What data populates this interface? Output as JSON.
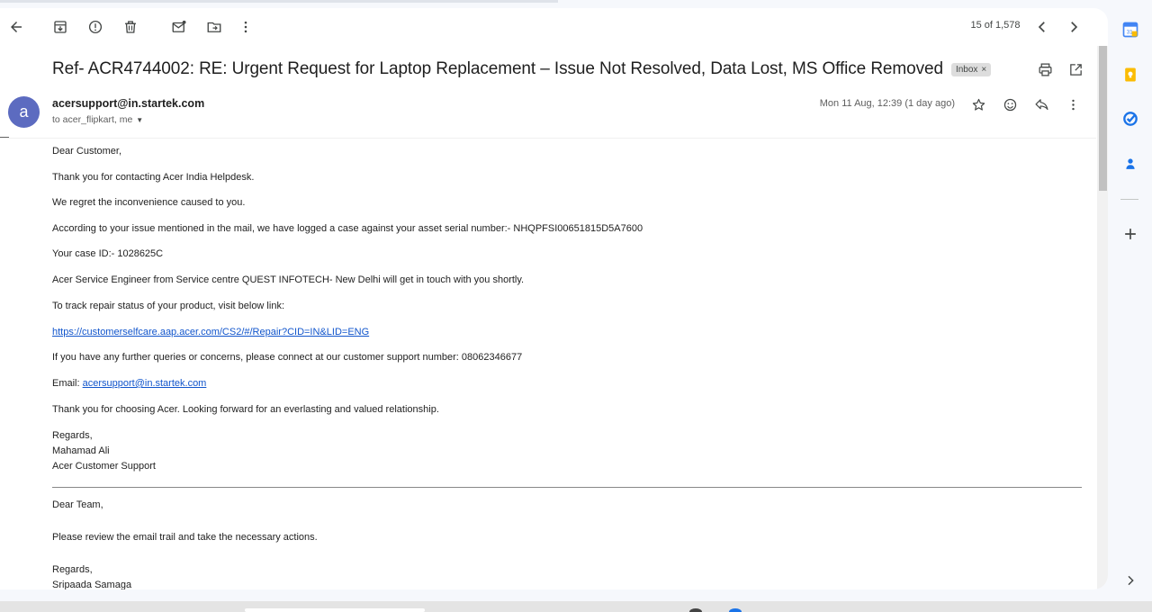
{
  "toolbar": {
    "counter": "15 of 1,578",
    "icons": [
      "back-arrow-icon",
      "archive-icon",
      "report-spam-icon",
      "delete-icon",
      "mark-unread-icon",
      "move-to-icon",
      "more-vert-icon",
      "prev-chevron-icon",
      "next-chevron-icon"
    ]
  },
  "email": {
    "subject": "Ref- ACR4744002: RE: Urgent Request for Laptop Replacement – Issue Not Resolved, Data Lost, MS Office Removed",
    "label_chip": "Inbox",
    "chip_close": "×",
    "avatar_letter": "a",
    "sender": "acersupport@in.startek.com",
    "recipients": "to acer_flipkart, me",
    "date": "Mon 11 Aug, 12:39 (1 day ago)"
  },
  "body": {
    "greeting": "Dear Customer,",
    "line1": "Thank you for contacting Acer India Helpdesk.",
    "line2": "We regret the inconvenience caused to you.",
    "line3": "According to your issue mentioned in the mail, we have logged a case against your asset serial number:- NHQPFSI00651815D5A7600",
    "line4": "Your case ID:- 1028625C",
    "line5": "Acer Service Engineer from Service centre QUEST INFOTECH- New Delhi will get in touch with you shortly.",
    "line6": "To track repair status of your product, visit below link:",
    "link": "https://customerselfcare.aap.acer.com/CS2/#/Repair?CID=IN&LID=ENG",
    "line7": "If you have any further queries or concerns, please connect at our customer support number: 08062346677",
    "email_label": "Email:",
    "email_link": "acersupport@in.startek.com",
    "line8": "Thank you for choosing Acer. Looking forward for an everlasting and valued relationship.",
    "regards": "Regards,",
    "sign_name": "Mahamad Ali",
    "sign_team": "Acer Customer Support",
    "greeting2": "Dear Team,",
    "line9": "Please review the email trail and take the necessary actions.",
    "regards2": "Regards,",
    "sign2": "Sripaada Samaga"
  },
  "side_panel": {
    "calendar_badge": "31"
  },
  "colors": {
    "accent": "#1a73e8",
    "link": "#1155cc",
    "avatar": "#5c6bc0",
    "keep": "#fbbc04"
  }
}
